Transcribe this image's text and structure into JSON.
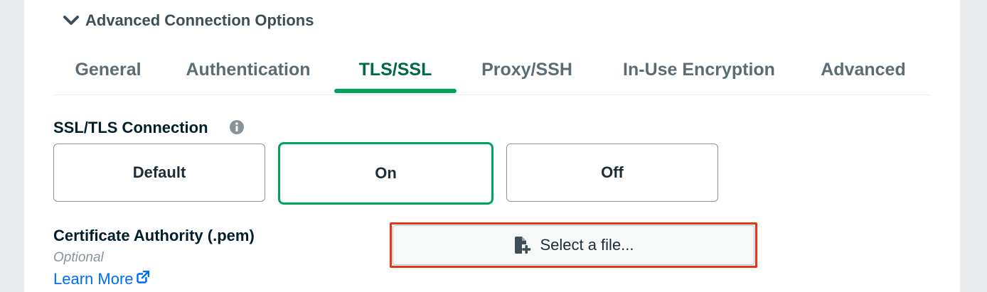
{
  "section": {
    "title": "Advanced Connection Options",
    "icon": "chevron-down-icon"
  },
  "tabs": [
    {
      "label": "General"
    },
    {
      "label": "Authentication"
    },
    {
      "label": "TLS/SSL"
    },
    {
      "label": "Proxy/SSH"
    },
    {
      "label": "In-Use Encryption"
    },
    {
      "label": "Advanced"
    }
  ],
  "active_tab": "TLS/SSL",
  "ssl": {
    "label": "SSL/TLS Connection",
    "info_icon": "info-icon",
    "options": [
      {
        "label": "Default"
      },
      {
        "label": "On"
      },
      {
        "label": "Off"
      }
    ],
    "selected": "On"
  },
  "certificate_authority": {
    "label": "Certificate Authority (.pem)",
    "optional": "Optional",
    "learn_more": "Learn More",
    "learn_more_icon": "external-link-icon",
    "file_button": "Select a file...",
    "file_icon": "file-add-icon"
  },
  "colors": {
    "active_tab": "#00684a",
    "active_underline": "#00a35c",
    "selected_border": "#00a35c",
    "highlight_border": "#e5361a",
    "link": "#016bf8"
  }
}
